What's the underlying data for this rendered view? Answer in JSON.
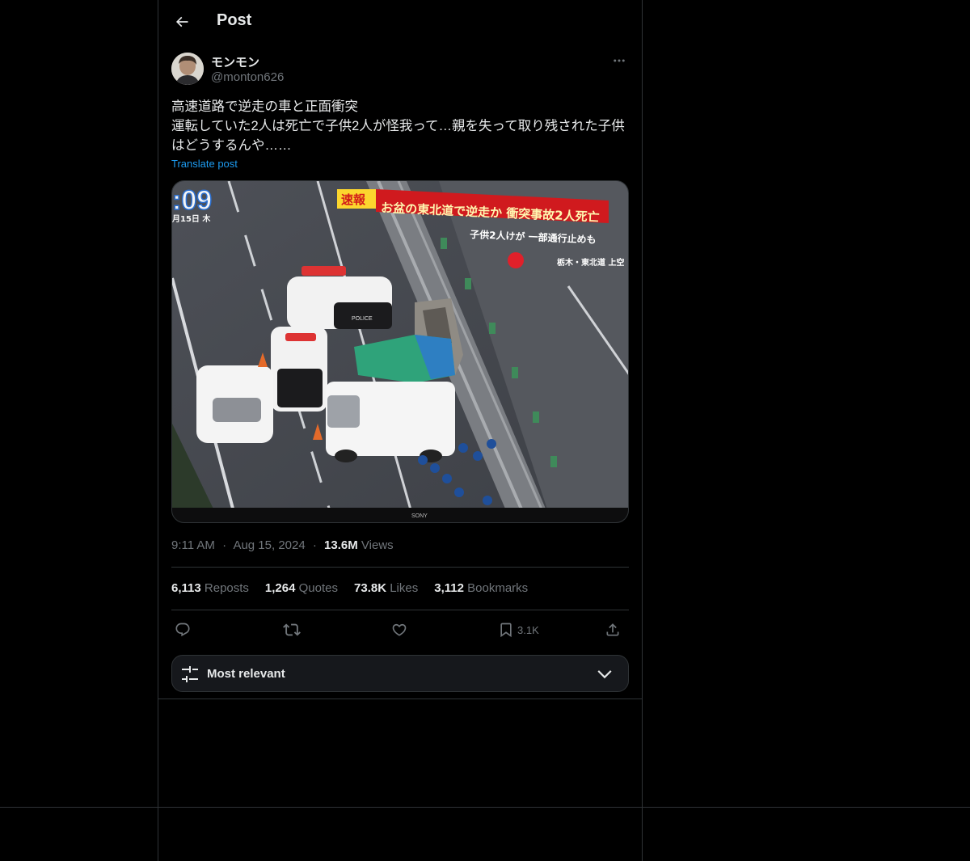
{
  "header": {
    "title": "Post"
  },
  "author": {
    "display_name": "モンモン",
    "handle": "@monton626"
  },
  "post": {
    "text": "高速道路で逆走の車と正面衝突\n運転していた2人は死亡で子供2人が怪我って…親を失って取り残された子供はどうするんや……",
    "translate_label": "Translate post"
  },
  "media": {
    "overlay_time": ":09",
    "overlay_date": "月15日 木",
    "breaking_tag": "速報",
    "headline": "お盆の東北道で逆走か 衝突事故2人死亡",
    "subheadline": "子供2人けが 一部通行止めも",
    "location": "栃木・東北道 上空",
    "police_label": "POLICE",
    "tv_brand": "SONY"
  },
  "meta": {
    "time": "9:11 AM",
    "date": "Aug 15, 2024",
    "sep": "·",
    "views_count": "13.6M",
    "views_label": "Views"
  },
  "stats": [
    {
      "count": "6,113",
      "label": "Reposts"
    },
    {
      "count": "1,264",
      "label": "Quotes"
    },
    {
      "count": "73.8K",
      "label": "Likes"
    },
    {
      "count": "3,112",
      "label": "Bookmarks"
    }
  ],
  "actions": {
    "bookmark_count": "3.1K"
  },
  "sort": {
    "label": "Most relevant"
  },
  "colors": {
    "background": "#000000",
    "text": "#e7e9ea",
    "muted": "#71767b",
    "accent": "#1d9bf0",
    "border": "#2f3336"
  }
}
